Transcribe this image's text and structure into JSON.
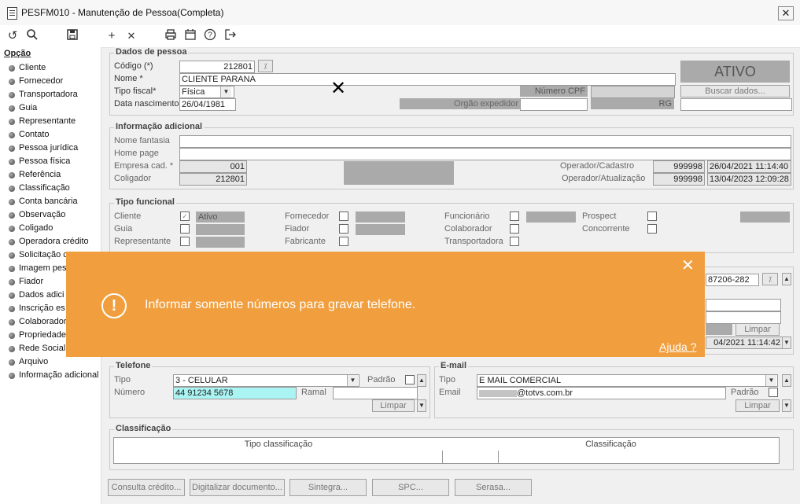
{
  "window": {
    "title": "PESFM010 - Manutenção de Pessoa(Completa)",
    "close_symbol": "✕"
  },
  "toolbar": {
    "undo": "↺",
    "search": "⚲",
    "save": "💾",
    "add": "+",
    "remove": "✕",
    "print": "🖶",
    "calendar": "▦",
    "help": "?",
    "exit": "⇥"
  },
  "sidebar": {
    "title": "Opção",
    "items": [
      "Cliente",
      "Fornecedor",
      "Transportadora",
      "Guia",
      "Representante",
      "Contato",
      "Pessoa jurídica",
      "Pessoa física",
      "Referência",
      "Classificação",
      "Conta bancária",
      "Observação",
      "Coligado",
      "Operadora crédito",
      "Solicitação c",
      "Imagem pes",
      "Fiador",
      "Dados adici",
      "Inscrição es",
      "Colaborador",
      "Propriedade",
      "Rede Social",
      "Arquivo",
      "Informação adicional"
    ]
  },
  "dados": {
    "title": "Dados de pessoa",
    "codigo_label": "Código (*)",
    "codigo": "212801",
    "nome_label": "Nome *",
    "nome": "CLIENTE PARANA",
    "tipo_fiscal_label": "Tipo fiscal*",
    "tipo_fiscal": "Física",
    "nasc_label": "Data nascimento",
    "nasc": "26/04/1981",
    "status": "ATIVO",
    "cpf_label": "Número CPF",
    "cpf": "",
    "buscar": "Buscar dados...",
    "orgao_label": "Orgão expedidor",
    "orgao": "",
    "rg_label": "RG",
    "rg": ""
  },
  "info": {
    "title": "Informação adicional",
    "fantasia_label": "Nome fantasia",
    "homepage_label": "Home page",
    "empresa_label": "Empresa cad. *",
    "empresa": "001",
    "coligador_label": "Coligador",
    "coligador": "212801",
    "op_cad_label": "Operador/Cadastro",
    "op_cad": "999998",
    "op_cad_date": "26/04/2021 11:14:40",
    "op_atu_label": "Operador/Atualização",
    "op_atu": "999998",
    "op_atu_date": "13/04/2023 12:09:28"
  },
  "funcional": {
    "title": "Tipo funcional",
    "cliente": "Cliente",
    "cliente_status": "Ativo",
    "fornecedor": "Fornecedor",
    "funcionario": "Funcionário",
    "prospect": "Prospect",
    "guia": "Guia",
    "fiador": "Fiador",
    "colaborador": "Colaborador",
    "concorrente": "Concorrente",
    "representante": "Representante",
    "fabricante": "Fabricante",
    "transportadora": "Transportadora"
  },
  "endereco": {
    "partial_code": "87206-282",
    "limpar": "Limpar",
    "date": "04/2021 11:14:42"
  },
  "toast": {
    "message": "Informar somente números para gravar telefone.",
    "help": "Ajuda ?",
    "icon": "!",
    "close": "✕"
  },
  "telefone": {
    "title": "Telefone",
    "tipo_label": "Tipo",
    "tipo": "3 - CELULAR",
    "padrao_label": "Padrão",
    "numero_label": "Número",
    "numero": "44 91234 5678",
    "ramal_label": "Ramal",
    "limpar": "Limpar"
  },
  "email": {
    "title": "E-mail",
    "tipo_label": "Tipo",
    "tipo": "E MAIL COMERCIAL",
    "email_label": "Email",
    "email": "@totvs.com.br",
    "padrao_label": "Padrão",
    "limpar": "Limpar"
  },
  "classificacao": {
    "title": "Classificação",
    "col1": "Tipo classificação",
    "col2": "Classificação"
  },
  "bottom": {
    "consulta": "Consulta crédito...",
    "digitalizar": "Digitalizar documento...",
    "sintegra": "Sintegra...",
    "spc": "SPC...",
    "serasa": "Serasa..."
  }
}
